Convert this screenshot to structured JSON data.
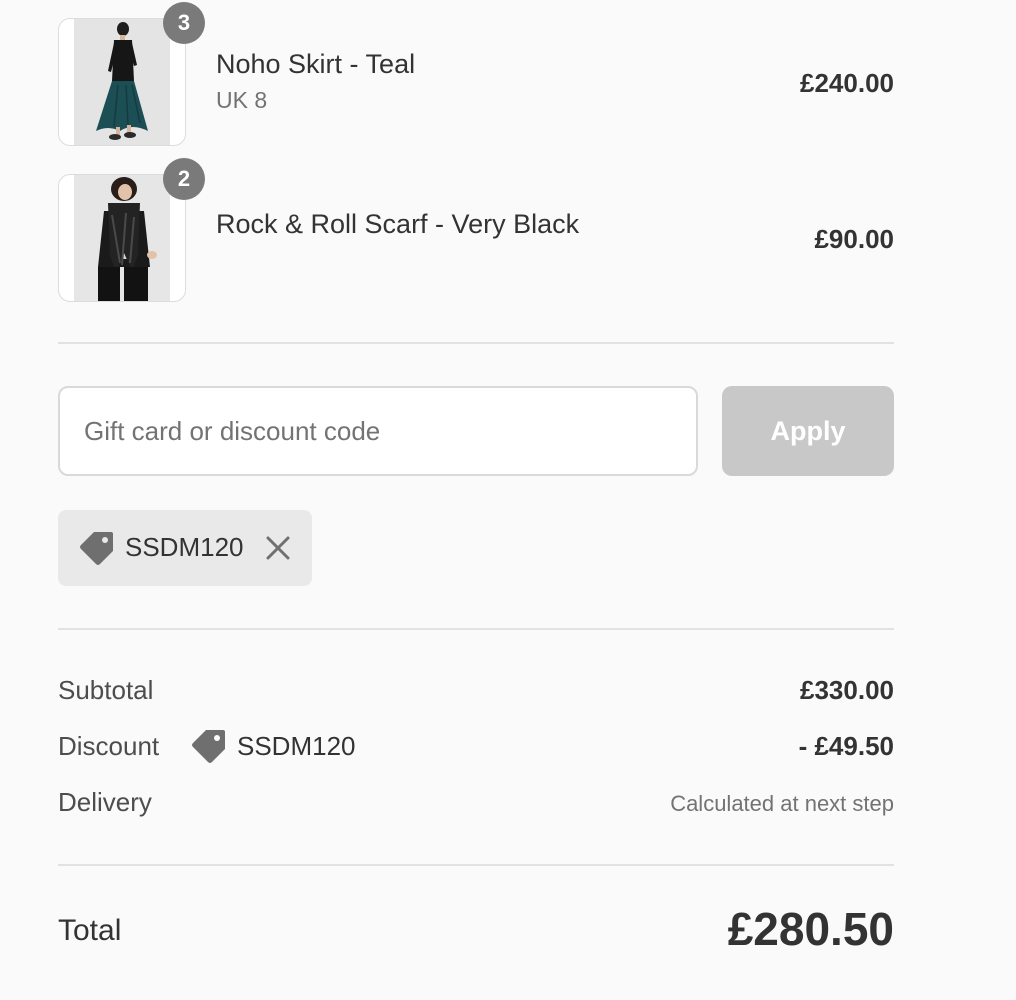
{
  "line_items": [
    {
      "name": "Noho Skirt - Teal",
      "variant": "UK 8",
      "price": "£240.00",
      "quantity": "3",
      "image_icon": "model-teal-skirt-photo"
    },
    {
      "name": "Rock & Roll Scarf - Very Black",
      "variant": "",
      "price": "£90.00",
      "quantity": "2",
      "image_icon": "model-black-scarf-photo"
    }
  ],
  "discount_form": {
    "placeholder": "Gift card or discount code",
    "value": "",
    "apply_label": "Apply"
  },
  "applied_code": {
    "code": "SSDM120",
    "tag_icon": "tag-icon",
    "remove_icon": "close-icon"
  },
  "summary": {
    "subtotal_label": "Subtotal",
    "subtotal_value": "£330.00",
    "discount_label": "Discount",
    "discount_code": "SSDM120",
    "discount_value": "- £49.50",
    "delivery_label": "Delivery",
    "delivery_value": "Calculated at next step",
    "total_label": "Total",
    "total_value": "£280.50"
  },
  "colors": {
    "page_background": "#fafafa",
    "text": "#333333",
    "muted_text": "#737373",
    "badge": "#7a7a7a",
    "apply_button_disabled": "#c8c8c8",
    "chip_background": "#e9e9e9"
  }
}
